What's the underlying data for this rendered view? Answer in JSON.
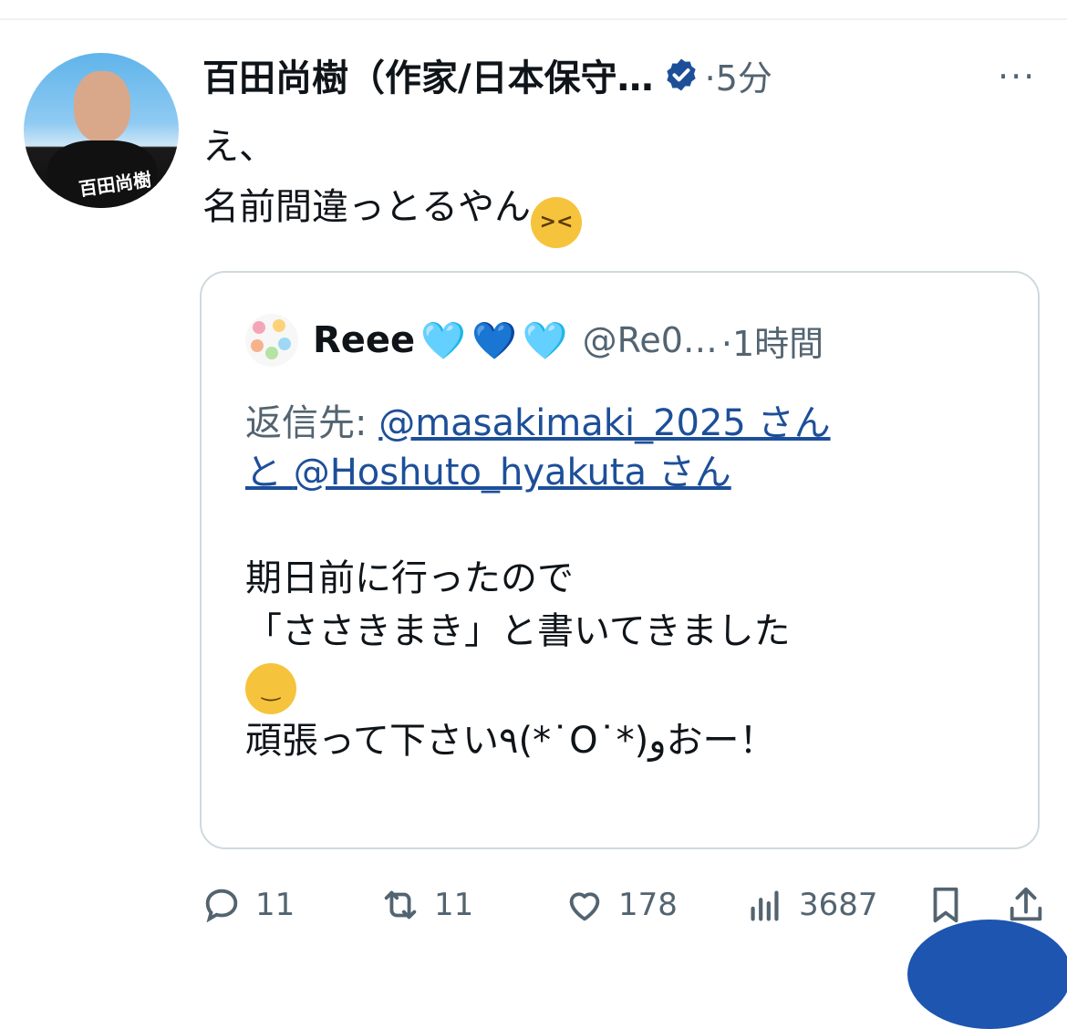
{
  "tweet": {
    "author_name": "百田尚樹（作家/日本保守…",
    "time": "·5分",
    "more": "···",
    "text_line1": "え、",
    "text_line2": "名前間違っとるやん",
    "avatar_caption": "百田尚樹"
  },
  "quote": {
    "author_name": "Reee",
    "hearts": [
      "🩵",
      "💙",
      "🩵"
    ],
    "handle": "@Re0…",
    "time": "·1時間",
    "reply_prefix": "返信先: ",
    "reply_user1": "@masakimaki_2025 さん",
    "reply_and": "と ",
    "reply_user2": "@Hoshuto_hyakuta さん",
    "body_line1": "期日前に行ったので",
    "body_line2": "「ささきまき」と書いてきました",
    "body_line4": "頑張って下さい٩(*˙O˙*)وおー！"
  },
  "actions": {
    "replies": "11",
    "retweets": "11",
    "likes": "178",
    "views": "3687"
  },
  "colors": {
    "accent": "#1d4f99",
    "secondary_text": "#536471",
    "border": "#cfd9de"
  },
  "icons": [
    "verified-badge-icon",
    "more-icon",
    "reply-icon",
    "retweet-icon",
    "like-icon",
    "views-icon",
    "bookmark-icon",
    "share-icon"
  ]
}
